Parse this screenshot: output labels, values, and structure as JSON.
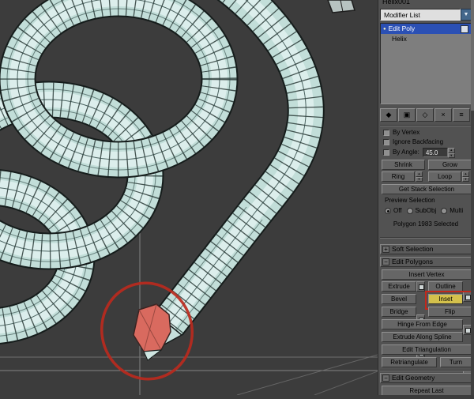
{
  "viewport": {
    "background": "#3c3c3c",
    "tube_color": "#c2ded9",
    "selected_polygon_color": "#d96a5f",
    "annotation_color": "#bb2a1e",
    "object": "helix spring with selected end polygon circled in red"
  },
  "icons": {
    "dropdown_arrow": "▼",
    "spinner_up": "▴",
    "spinner_down": "▾",
    "plus": "+",
    "minus": "−",
    "bulb": "●"
  },
  "panel": {
    "object_name": "Helix001",
    "modifier_list_label": "Modifier List",
    "stack": {
      "selected_modifier": "Edit Poly",
      "base_object": "Helix"
    },
    "stack_toolbar": [
      {
        "name": "pin-stack",
        "glyph": "◆"
      },
      {
        "name": "show-end-result",
        "glyph": "▣"
      },
      {
        "name": "make-unique",
        "glyph": "◇"
      },
      {
        "name": "remove-modifier",
        "glyph": "×"
      },
      {
        "name": "configure-modifier-sets",
        "glyph": "≡"
      }
    ],
    "selection": {
      "by_vertex": "By Vertex",
      "ignore_backfacing": "Ignore Backfacing",
      "by_angle": "By Angle:",
      "angle_value": "45.0",
      "shrink": "Shrink",
      "grow": "Grow",
      "ring": "Ring",
      "loop": "Loop",
      "get_stack_selection": "Get Stack Selection",
      "preview_label": "Preview Selection",
      "preview_off": "Off",
      "preview_subobj": "SubObj",
      "preview_multi": "Multi",
      "status": "Polygon 1983 Selected"
    },
    "rollouts": {
      "soft_selection": "Soft Selection",
      "edit_polygons": "Edit Polygons",
      "edit_geometry": "Edit Geometry"
    },
    "edit_polygons": {
      "insert_vertex": "Insert Vertex",
      "extrude": "Extrude",
      "outline": "Outline",
      "bevel": "Bevel",
      "inset": "Inset",
      "bridge": "Bridge",
      "flip": "Flip",
      "hinge_from_edge": "Hinge From Edge",
      "extrude_along_spline": "Extrude Along Spline",
      "edit_triangulation": "Edit Triangulation",
      "retriangulate": "Retriangulate",
      "turn": "Turn"
    },
    "edit_geometry": {
      "repeat_last": "Repeat Last"
    }
  }
}
